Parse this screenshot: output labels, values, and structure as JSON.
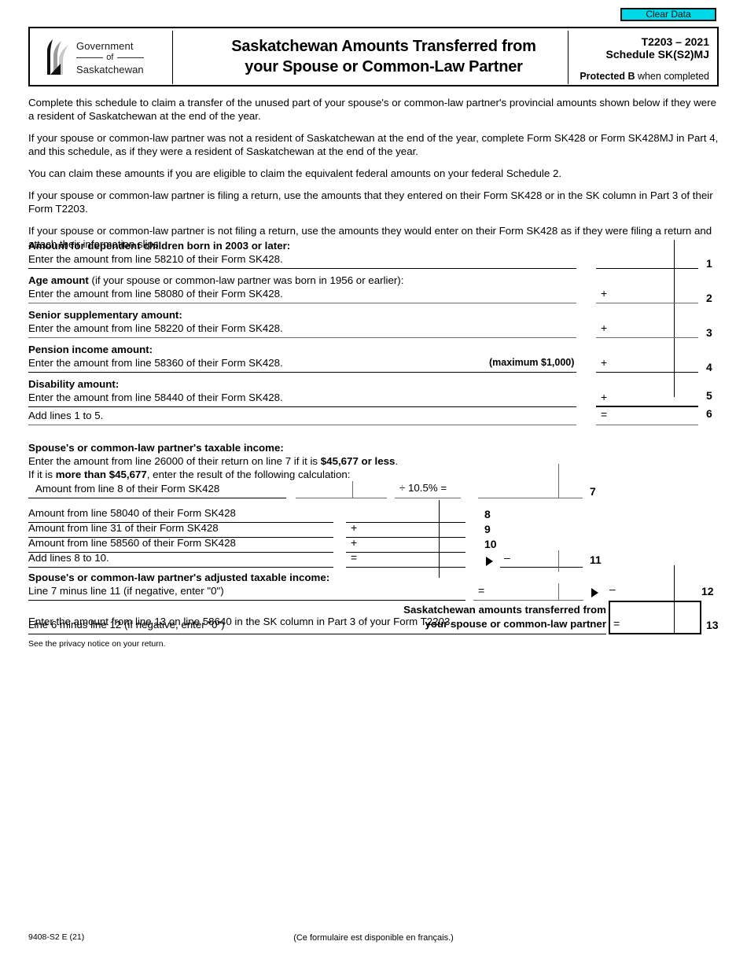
{
  "buttons": {
    "clear_data": "Clear Data"
  },
  "header": {
    "logo": {
      "line1": "Government",
      "line2": "of",
      "line3": "Saskatchewan",
      "icon": "saskatchewan-wheat-sheaf-logo"
    },
    "title_line1": "Saskatchewan Amounts Transferred from",
    "title_line2": "your Spouse or Common-Law Partner",
    "form_id": "T2203 – 2021",
    "schedule": "Schedule SK(S2)MJ",
    "protected_bold": "Protected B",
    "protected_rest": " when completed"
  },
  "intro": [
    "Complete this schedule to claim a transfer of the unused part of your spouse's or common-law partner's provincial amounts shown below if they were a resident of Saskatchewan at the end of the year.",
    "If your spouse or common-law partner was not a resident of Saskatchewan at the end of the year, complete Form SK428 or Form SK428MJ in Part 4, and this schedule, as if they were a resident of Saskatchewan at the end of the year.",
    "You can claim these amounts if you are eligible to claim the equivalent federal amounts on your federal Schedule 2.",
    "If your spouse or common-law partner is filing a return, use the amounts that they entered on their Form SK428 or in the SK column in Part 3 of their Form T2203.",
    "If your spouse or common-law partner is not filing a return, use the amounts they would enter on their Form SK428 as if they were filing a return and attach their information slips."
  ],
  "lines": {
    "l1": {
      "heading": "Amount for dependent children born in 2003 or later:",
      "text": "Enter the amount from line 58210 of their Form SK428.",
      "no": "1",
      "op": ""
    },
    "l2": {
      "heading_bold": "Age amount",
      "heading_rest": " (if your spouse or common-law partner was born in 1956 or earlier):",
      "text": "Enter the amount from line 58080 of their Form SK428.",
      "no": "2",
      "op": "+"
    },
    "l3": {
      "heading": "Senior supplementary amount:",
      "text": "Enter the amount from line 58220 of their Form SK428.",
      "no": "3",
      "op": "+"
    },
    "l4": {
      "heading": "Pension income amount:",
      "text": "Enter the amount from line 58360 of their Form SK428.",
      "note": "(maximum $1,000)",
      "no": "4",
      "op": "+"
    },
    "l5": {
      "heading": "Disability amount:",
      "text": "Enter the amount from line 58440 of their Form SK428.",
      "no": "5",
      "op": "+"
    },
    "l6": {
      "text": "Add lines 1 to 5.",
      "no": "6",
      "op": "="
    },
    "l7": {
      "heading": "Spouse's or common-law partner's taxable income:",
      "text_a1": "Enter the amount from line 26000 of their return on line 7 if it is ",
      "text_a2": "$45,677 or less",
      "text_a3": ".",
      "text_b1": "If it is ",
      "text_b2": "more than $45,677",
      "text_b3": ", enter the result of the following calculation:",
      "sub_label": "Amount from line 8 of their Form SK428",
      "divide_label": "÷  10.5%  =",
      "no": "7"
    },
    "l8": {
      "text": "Amount from line 58040 of their Form SK428",
      "no": "8",
      "op": ""
    },
    "l9": {
      "text": "Amount from line 31 of their Form SK428",
      "no": "9",
      "op": "+"
    },
    "l10": {
      "text": "Amount from line 58560 of their Form SK428",
      "no": "10",
      "op": "+"
    },
    "l11": {
      "text": "Add lines 8 to 10.",
      "no": "11",
      "op": "=",
      "op2": "–"
    },
    "l12": {
      "heading": "Spouse's or common-law partner's adjusted taxable income:",
      "text": "Line 7 minus line 11 (if negative, enter \"0\")",
      "no": "12",
      "op": "=",
      "op2": "–"
    },
    "l13": {
      "text": "Line 6 minus line 12 (if negative, enter \"0\")",
      "caption_line1": "Saskatchewan amounts transferred from",
      "caption_line2": "your spouse or common-law partner",
      "no": "13",
      "op": "="
    }
  },
  "closing": "Enter the amount from line 13 on line 58640 in the SK column in Part 3 of your Form T2203.",
  "privacy": "See the privacy notice on your return.",
  "footer": {
    "code": "9408-S2 E (21)",
    "french": "(Ce formulaire est disponible en français.)"
  }
}
